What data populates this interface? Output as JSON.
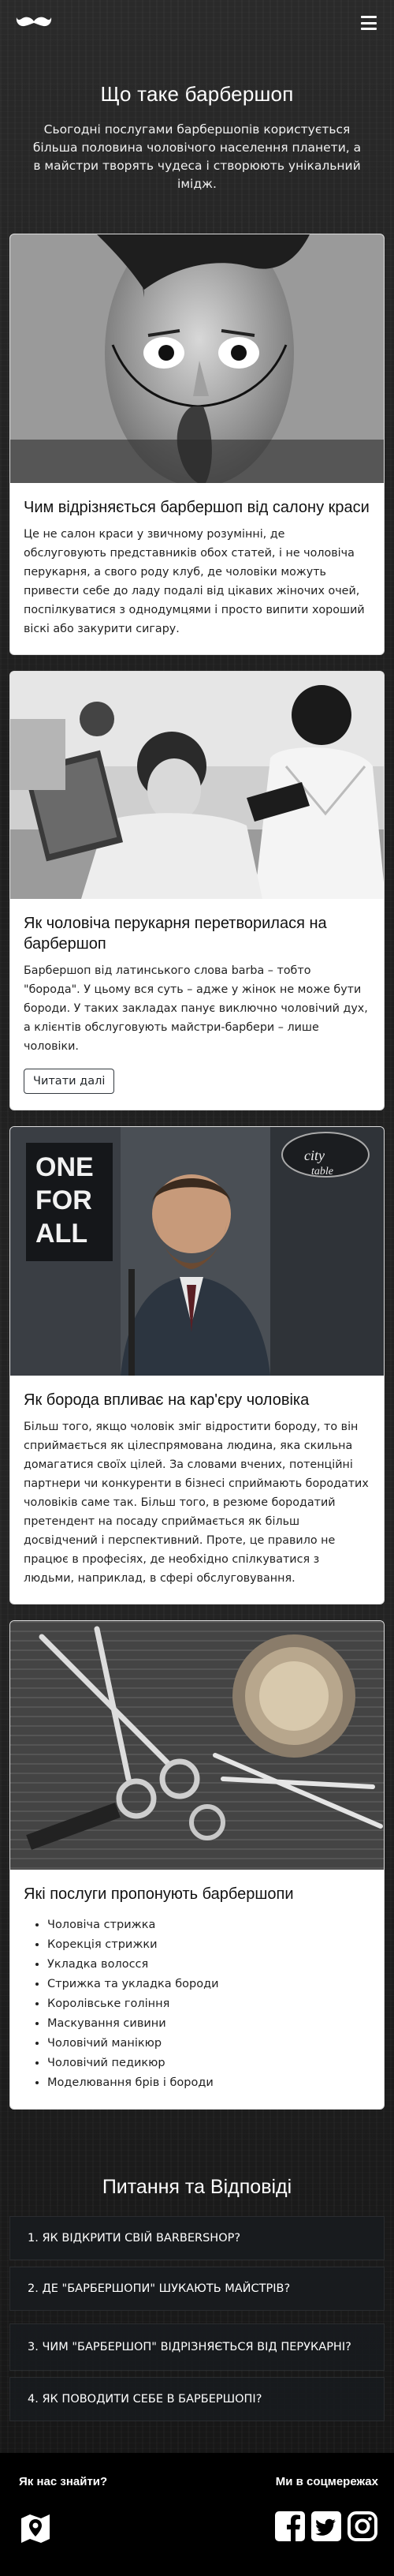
{
  "hero": {
    "title": "Що таке барбершоп",
    "text": "Сьогодні послугами барбершопів користується більша половина чоловічого населення планети, а в майстри творять чудеса і створюють унікальний імідж."
  },
  "cards": [
    {
      "title": "Чим відрізняється барбершоп від салону краси",
      "text": "Це не салон краси у звичному розумінні, де обслуговують представників обох статей, і не чоловіча перукарня, а свого роду клуб, де чоловіки можуть привести себе до ладу подалі від цікавих жіночих очей, поспілкуватися з однодумцями і просто випити хороший віскі або закурити сигару."
    },
    {
      "title": "Як чоловіча перукарня перетворилася на барбершоп",
      "text": "Барбершоп від латинського слова barba – тобто \"борода\". У цьому вся суть – адже у жінок не може бути бороди. У таких закладах панує виключно чоловічий дух, а клієнтів обслуговують майстри-барбери – лише чоловіки.",
      "button": "Читати далі"
    },
    {
      "title": "Як борода впливає на кар'єру чоловіка",
      "text": "Більш того, якщо чоловік зміг відростити бороду, то він сприймається як цілеспрямована людина, яка скильна домагатися своїх цілей. За словами вчених, потенційні партнери чи конкуренти в бізнесі сприймають бородатих чоловіків саме так. Більш того, в резюме бородатий претендент на посаду сприймається як більш досвідчений і перспективний. Проте, це правило не працює в професіях, де необхідно спілкуватися з людьми, наприклад, в сфері обслуговування.",
      "image_text": [
        "ONE",
        "FOR",
        "ALL"
      ]
    },
    {
      "title": "Які послуги пропонують барбершопи",
      "services": [
        "Чоловіча стрижка",
        "Корекція стрижки",
        "Укладка волосся",
        "Стрижка та укладка бороди",
        "Королівське гоління",
        "Маскування сивини",
        "Чоловічий манікюр",
        "Чоловічий педикюр",
        "Моделювання брів і бороди"
      ]
    }
  ],
  "faq": {
    "title": "Питання та Відповіді",
    "items": [
      "1. ЯК ВІДКРИТИ СВІЙ BARBERSHOP?",
      "2. ДЕ \"БАРБЕРШОПИ\" ШУКАЮТЬ МАЙСТРІВ?",
      "3. ЧИМ \"БАРБЕРШОП\" ВІДРІЗНЯЄТЬСЯ ВІД ПЕРУКАРНІ?",
      "4. ЯК ПОВОДИТИ СЕБЕ В БАРБЕРШОПІ?"
    ]
  },
  "footer": {
    "find_us": "Як нас знайти?",
    "social": "Ми в соцмережах"
  },
  "icons": {
    "logo": "mustache-icon",
    "menu": "hamburger-icon",
    "map": "map-icon",
    "social": [
      "facebook-icon",
      "twitter-icon",
      "instagram-icon"
    ]
  }
}
